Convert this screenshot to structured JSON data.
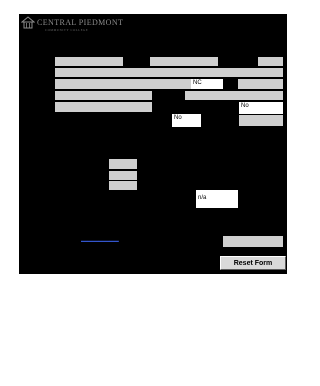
{
  "header": {
    "logo_text": "CENTRAL PIEDMONT",
    "logo_subtext": "COMMUNITY COLLEGE"
  },
  "form": {
    "state_value": "NC",
    "answer_1": "No",
    "answer_2": "No",
    "na_value": "n/a",
    "link_text": "_________________",
    "reset_label": "Reset Form"
  }
}
